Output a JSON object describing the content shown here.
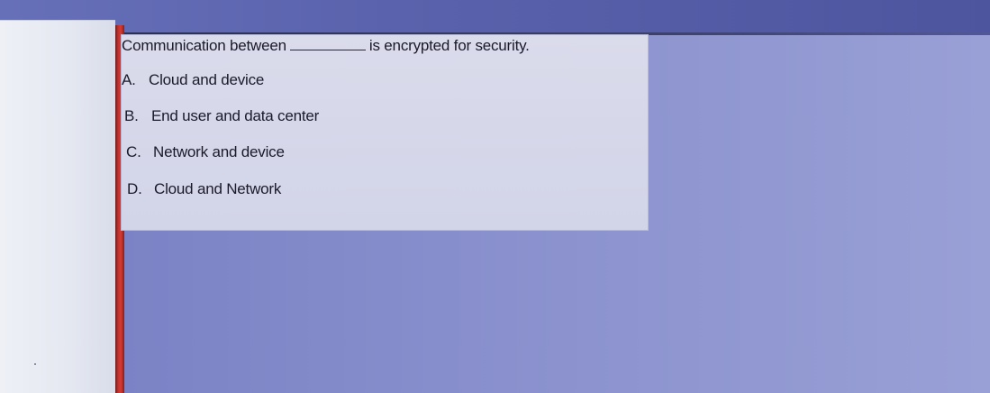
{
  "question": {
    "text_before": "Communication between",
    "text_after": "is encrypted for security."
  },
  "options": [
    {
      "letter": "A.",
      "label": "Cloud and device"
    },
    {
      "letter": "B.",
      "label": "End user and data center"
    },
    {
      "letter": "C.",
      "label": "Network and device"
    },
    {
      "letter": "D.",
      "label": "Cloud and Network"
    }
  ],
  "colors": {
    "accent_bar": "#d83b33",
    "question_background": "#d6d8ea",
    "screen_background": "#8c93cf"
  }
}
